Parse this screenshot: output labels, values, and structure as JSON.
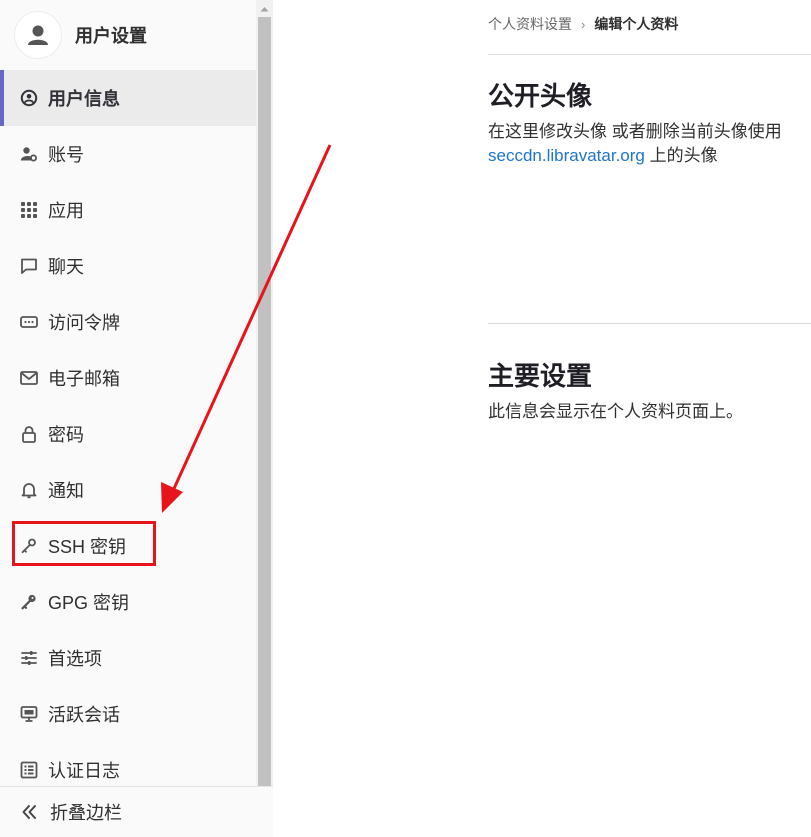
{
  "sidebar": {
    "header_title": "用户设置",
    "items": [
      {
        "label": "用户信息",
        "icon": "profile-icon",
        "active": true
      },
      {
        "label": "账号",
        "icon": "account-icon"
      },
      {
        "label": "应用",
        "icon": "applications-icon"
      },
      {
        "label": "聊天",
        "icon": "chat-icon"
      },
      {
        "label": "访问令牌",
        "icon": "token-icon"
      },
      {
        "label": "电子邮箱",
        "icon": "mail-icon"
      },
      {
        "label": "密码",
        "icon": "lock-icon"
      },
      {
        "label": "通知",
        "icon": "bell-icon"
      },
      {
        "label": "SSH 密钥",
        "icon": "key-icon"
      },
      {
        "label": "GPG 密钥",
        "icon": "key-icon"
      },
      {
        "label": "首选项",
        "icon": "preferences-icon"
      },
      {
        "label": "活跃会话",
        "icon": "monitor-icon"
      },
      {
        "label": "认证日志",
        "icon": "log-icon"
      }
    ],
    "collapse_label": "折叠边栏"
  },
  "breadcrumb": {
    "parent": "个人资料设置",
    "current": "编辑个人资料"
  },
  "avatar_section": {
    "title": "公开头像",
    "desc_prefix": "在这里修改头像 或者删除当前头像使用",
    "link": "seccdn.libravatar.org",
    "desc_suffix": " 上的头像"
  },
  "main_section": {
    "title": "主要设置",
    "desc": "此信息会显示在个人资料页面上。"
  },
  "colors": {
    "active_border": "#6666c4",
    "annotation": "#e8141c",
    "link": "#1f75cb"
  }
}
